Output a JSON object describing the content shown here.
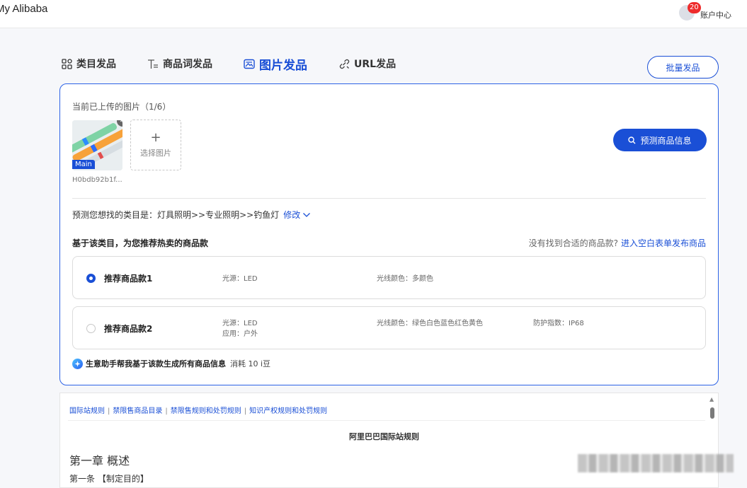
{
  "header": {
    "brand": "My Alibaba",
    "notif_count": "20",
    "account_label": "账户中心"
  },
  "tabs": [
    {
      "label": "类目发品",
      "icon": "grid-icon"
    },
    {
      "label": "商品词发品",
      "icon": "text-icon"
    },
    {
      "label": "图片发品",
      "icon": "image-icon",
      "active": true
    },
    {
      "label": "URL发品",
      "icon": "link-icon"
    }
  ],
  "batch_button": "批量发品",
  "upload": {
    "title": "当前已上传的图片（1/6）",
    "main_tag": "Main",
    "file_name": "H0bdb92b1f...",
    "add_label": "选择图片",
    "add_symbol": "+",
    "predict_button": "预测商品信息"
  },
  "category": {
    "text": "预测您想找的类目是：灯具照明>>专业照明>>钓鱼灯",
    "edit_label": "修改"
  },
  "recommend": {
    "title": "基于该类目，为您推荐热卖的商品款",
    "not_found": "没有找到合适的商品款?",
    "blank_form_link": "进入空白表单发布商品",
    "options": [
      {
        "name": "推荐商品款1",
        "selected": true,
        "attrs": [
          "光源：LED",
          "光线颜色：多颜色"
        ]
      },
      {
        "name": "推荐商品款2",
        "selected": false,
        "attrs": [
          "光源：LED",
          "应用：户外",
          "光线颜色：绿色白色蓝色红色黄色",
          "防护指数：IP68"
        ]
      }
    ]
  },
  "assistant": {
    "action": "生意助手帮我基于该款生成所有商品信息",
    "cost": "消耗 10 i豆"
  },
  "rules": {
    "links": [
      "国际站规则",
      "禁限售商品目录",
      "禁限售规则和处罚规则",
      "知识产权规则和处罚规则"
    ],
    "separator": "|",
    "heading": "阿里巴巴国际站规则",
    "chapter": "第一章 概述",
    "article": "第一条 【制定目的】"
  },
  "colors": {
    "accent": "#1a4fd6",
    "badge": "#ee2b2b"
  }
}
